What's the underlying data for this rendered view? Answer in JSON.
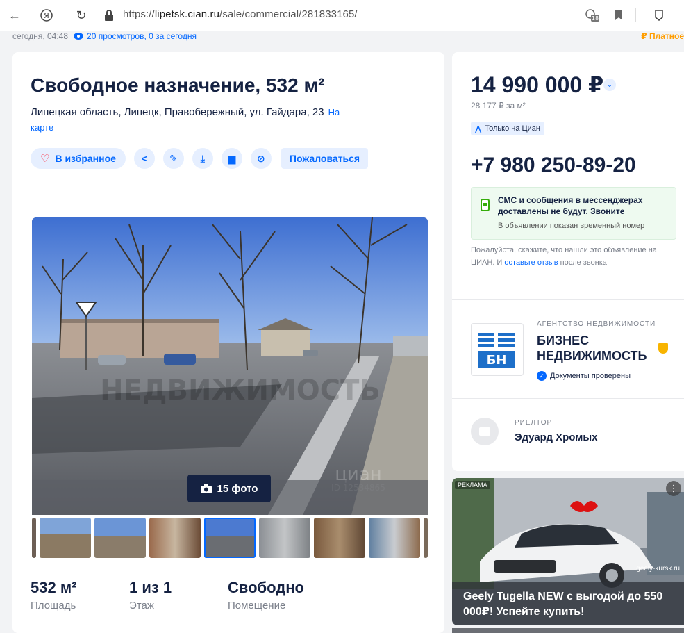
{
  "browser": {
    "url_prefix": "https://",
    "url_domain": "lipetsk.cian.ru",
    "url_path": "/sale/commercial/281833165/",
    "badge_count": "18"
  },
  "meta": {
    "date": "сегодня, 04:48",
    "views": "20 просмотров, 0 за сегодня",
    "paid_label": "₽ Платное"
  },
  "listing": {
    "title": "Свободное назначение, 532 м²",
    "address": "Липецкая область, Липецк, Правобережный, ул. Гайдара, 23",
    "map_link": "На карте",
    "favorite_label": "В избранное",
    "complain_label": "Пожаловаться",
    "photo_count_label": "15 фото",
    "photo_watermark": "НЕДВИЖИМОСТЬ",
    "photo_watermark_id": "ID 12534865",
    "photo_watermark_brand": "циан"
  },
  "stats": [
    {
      "value": "532 м²",
      "label": "Площадь"
    },
    {
      "value": "1 из 1",
      "label": "Этаж"
    },
    {
      "value": "Свободно",
      "label": "Помещение"
    }
  ],
  "sidebar": {
    "price": "14 990 000 ₽",
    "price_per_meter": "28 177 ₽ за м²",
    "only_cian": "Только на Циан",
    "phone": "+7 980 250-89-20",
    "sms_warning": "СМС и сообщения в мессенджерах доставлены не будут. Звоните",
    "temp_number": "В объявлении показан временный номер",
    "feedback_before": "Пожалуйста, скажите, что нашли это объявление на ЦИАН. И ",
    "feedback_link": "оставьте отзыв",
    "feedback_after": " после звонка",
    "agency_type": "АГЕНТСТВО НЕДВИЖИМОСТИ",
    "agency_name": "БИЗНЕС НЕДВИЖИМОСТЬ",
    "agency_logo_text": "БН",
    "documents_checked": "Документы проверены",
    "realtor_type": "РИЕЛТОР",
    "realtor_name": "Эдуард Хромых"
  },
  "ad": {
    "tag": "РЕКЛАМА",
    "domain": "geely-kursk.ru",
    "text": "Geely Tugella NEW с выгодой до 550 000₽! Успейте купить!"
  },
  "colors": {
    "accent": "#0468ff",
    "text": "#152242",
    "paid": "#ff9d00",
    "success": "#34ac0a"
  }
}
